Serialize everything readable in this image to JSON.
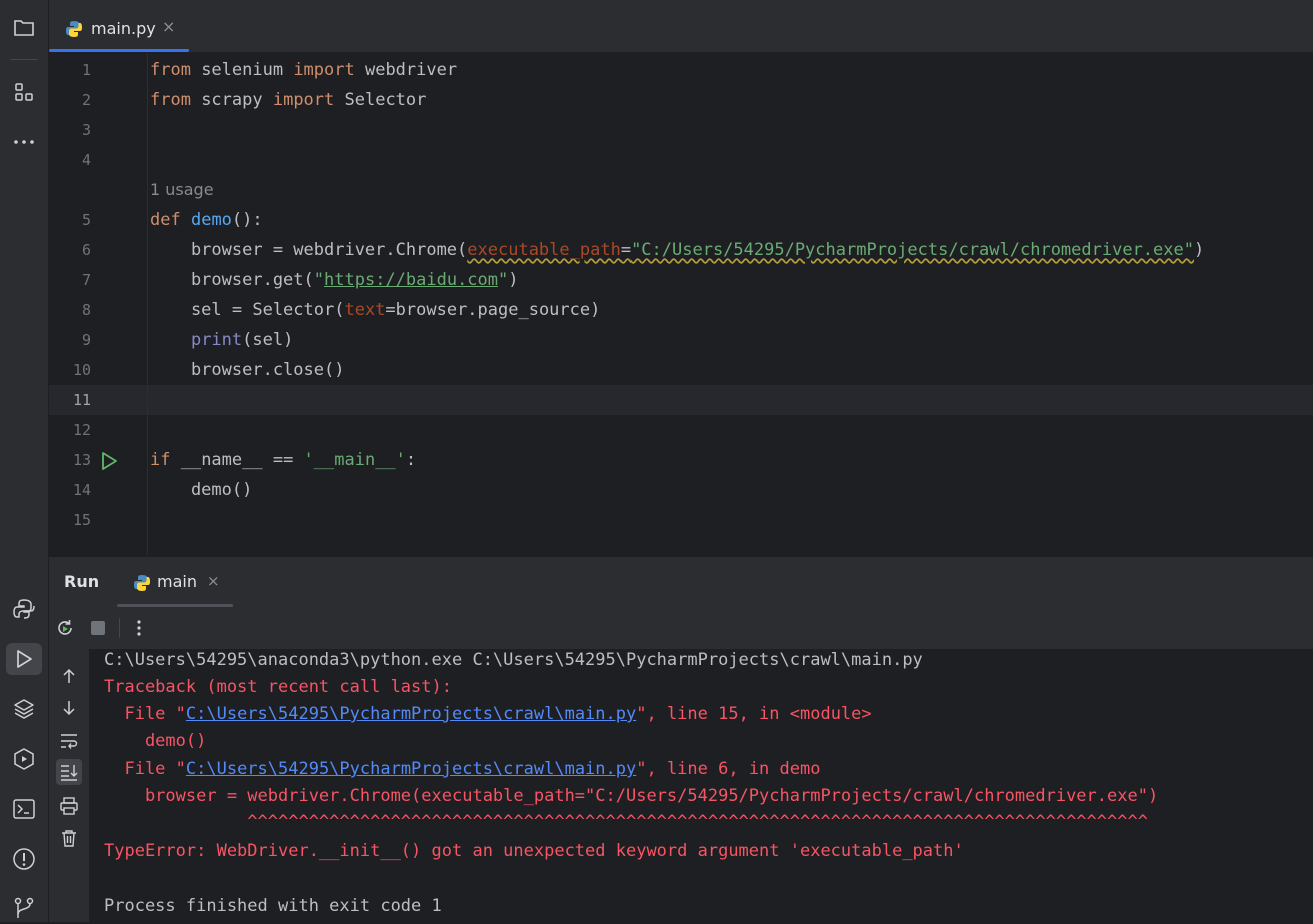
{
  "editor_tab": {
    "label": "main.py",
    "close": "×"
  },
  "gutter": {
    "line_numbers": [
      "1",
      "2",
      "3",
      "4",
      "5",
      "6",
      "7",
      "8",
      "9",
      "10",
      "11",
      "12",
      "13",
      "14",
      "15"
    ]
  },
  "code": {
    "l1": {
      "kw1": "from",
      "mod": " selenium ",
      "kw2": "import",
      "name": " webdriver"
    },
    "l2": {
      "kw1": "from",
      "mod": " scrapy ",
      "kw2": "import",
      "name": " Selector"
    },
    "usage_hint": "1 usage",
    "l5": {
      "kw": "def",
      "sp": " ",
      "fn": "demo",
      "rest": "():"
    },
    "l6": {
      "pre": "    browser = webdriver.Chrome(",
      "param": "executable_path",
      "eq": "=",
      "str": "\"C:/Users/54295/PycharmProjects/crawl/chromedriver.exe\"",
      "post": ")"
    },
    "l7": {
      "pre": "    browser.get(",
      "q1": "\"",
      "url": "https://baidu.com",
      "q2": "\"",
      "post": ")"
    },
    "l8": {
      "pre": "    sel = Selector(",
      "param": "text",
      "post": "=browser.page_source)"
    },
    "l9": {
      "pre": "    ",
      "builtin": "print",
      "post": "(sel)"
    },
    "l10": {
      "text": "    browser.close()"
    },
    "l13": {
      "kw": "if",
      "mid": " __name__ == ",
      "str": "'__main__'",
      "post": ":"
    },
    "l14": {
      "text": "    demo()"
    }
  },
  "run_panel": {
    "title": "Run",
    "tab_label": "main",
    "tab_close": "×"
  },
  "console": {
    "cmd": "C:\\Users\\54295\\anaconda3\\python.exe C:\\Users\\54295\\PycharmProjects\\crawl\\main.py",
    "traceback": "Traceback (most recent call last):",
    "file1_pre": "  File \"",
    "file1_link": "C:\\Users\\54295\\PycharmProjects\\crawl\\main.py",
    "file1_post": "\", line 15, in <module>",
    "demo_call": "    demo()",
    "file2_pre": "  File \"",
    "file2_link": "C:\\Users\\54295\\PycharmProjects\\crawl\\main.py",
    "file2_post": "\", line 6, in demo",
    "browser_line": "    browser = webdriver.Chrome(executable_path=\"C:/Users/54295/PycharmProjects/crawl/chromedriver.exe\")",
    "carets": "              ^^^^^^^^^^^^^^^^^^^^^^^^^^^^^^^^^^^^^^^^^^^^^^^^^^^^^^^^^^^^^^^^^^^^^^^^^^^^^^^^^^^^^^^^",
    "type_error": "TypeError: WebDriver.__init__() got an unexpected keyword argument 'executable_path'",
    "process_finished": "Process finished with exit code 1"
  },
  "icons": {
    "activity": [
      "folder-icon",
      "structure-icon",
      "more-icon",
      "python-console-icon",
      "run-icon",
      "layers-icon",
      "services-icon",
      "terminal-icon",
      "problems-icon",
      "git-icon"
    ]
  },
  "colors": {
    "background": "#1e1f22",
    "panel": "#2b2d30",
    "keyword": "#cf8e6d",
    "string": "#6aab73",
    "function": "#56a8f5",
    "error": "#f75464",
    "link": "#548af7",
    "accent": "#3574f0"
  }
}
